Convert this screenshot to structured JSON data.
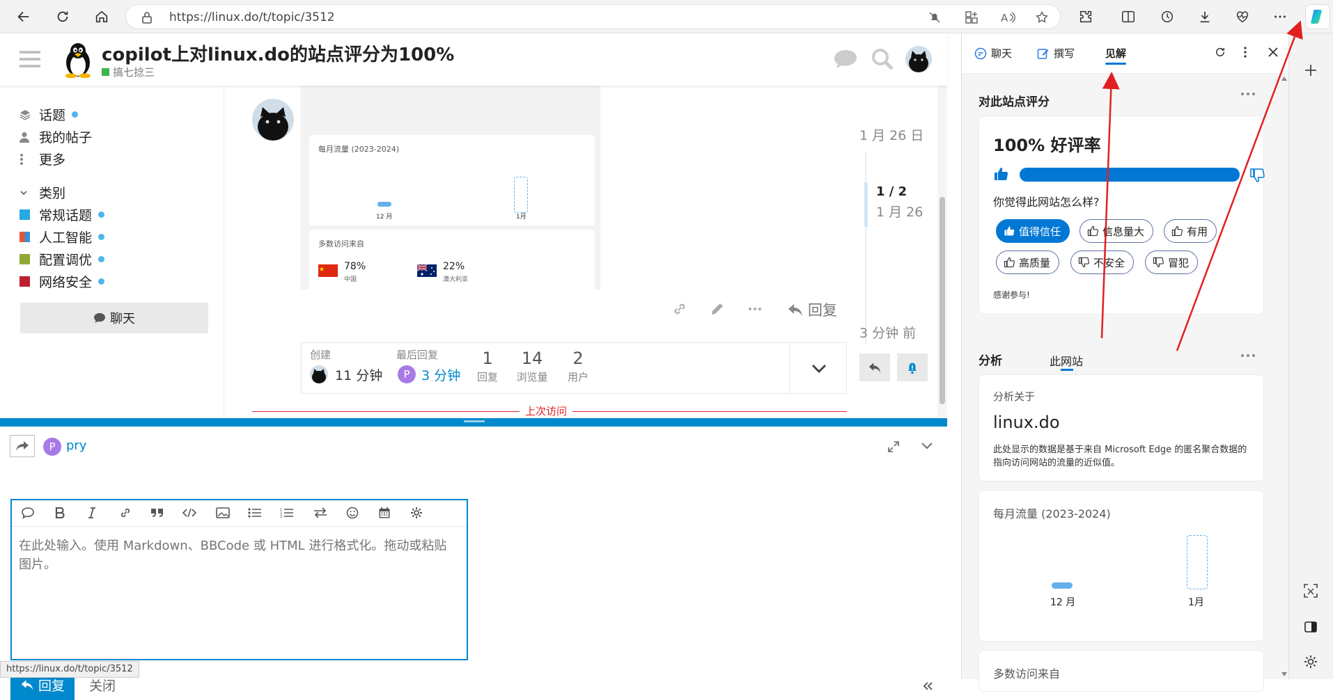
{
  "browser": {
    "url": "https://linux.do/t/topic/3512",
    "status_url": "https://linux.do/t/topic/3512"
  },
  "topic": {
    "title": "copilot上对linux.do的站点评分为100%",
    "category": "搞七捻三"
  },
  "sidebar": {
    "items": [
      {
        "label": "话题"
      },
      {
        "label": "我的帖子"
      },
      {
        "label": "更多"
      }
    ],
    "categories_heading": "类别",
    "categories": [
      {
        "label": "常规话题",
        "color": "#25AAE2"
      },
      {
        "label": "人工智能",
        "color": "#E45735"
      },
      {
        "label": "配置调优",
        "color": "#92A836"
      },
      {
        "label": "网络安全",
        "color": "#BF1E2E"
      }
    ],
    "chat_label": "聊天"
  },
  "post_image": {
    "traffic_title": "每月流量 (2023-2024)",
    "month1": "12 月",
    "month2": "1月",
    "visitors_title": "多数访问来自",
    "country1_pct": "78%",
    "country1_name": "中国",
    "country2_pct": "22%",
    "country2_name": "澳大利亚"
  },
  "post_actions": {
    "reply_label": "回复"
  },
  "topic_map": {
    "created_label": "创建",
    "created_time": "11 分钟",
    "last_reply_label": "最后回复",
    "last_reply_time": "3 分钟",
    "replies_count": "1",
    "replies_label": "回复",
    "views_count": "14",
    "views_label": "浏览量",
    "users_count": "2",
    "users_label": "用户"
  },
  "timeline": {
    "top_date": "1 月 26 日",
    "position": "1 / 2",
    "current_date": "1 月 26",
    "bottom_time": "3 分钟 前"
  },
  "last_visit_label": "上次访问",
  "composer": {
    "user_initial": "P",
    "username": "pry",
    "placeholder": "在此处输入。使用 Markdown、BBCode 或 HTML 进行格式化。拖动或粘贴图片。",
    "reply_button": "回复",
    "close_button": "关闭"
  },
  "last_reply_avatar_initial": "P",
  "panel": {
    "tabs": [
      "聊天",
      "撰写",
      "见解"
    ],
    "rating_section_title": "对此站点评分",
    "rating_headline": "100% 好评率",
    "rating_value": 1.0,
    "question": "你觉得此网站怎么样?",
    "feedback_options": [
      "值得信任",
      "信息量大",
      "有用",
      "高质量",
      "不安全",
      "冒犯"
    ],
    "thanks": "感谢参与!",
    "analysis_title": "分析",
    "analysis_tab": "此网站",
    "analysis_about_label": "分析关于",
    "analysis_domain": "linux.do",
    "analysis_desc": "此处显示的数据是基于来自 Microsoft Edge 的匿名聚合数据的指向访问网站的流量的近似值。",
    "traffic_title": "每月流量 (2023-2024)",
    "month1": "12 月",
    "month2": "1月",
    "visitors_title": "多数访问来自"
  },
  "colors": {
    "accent": "#0078D4",
    "discourse_blue": "#0088CC",
    "annotation_red": "#E02020"
  }
}
